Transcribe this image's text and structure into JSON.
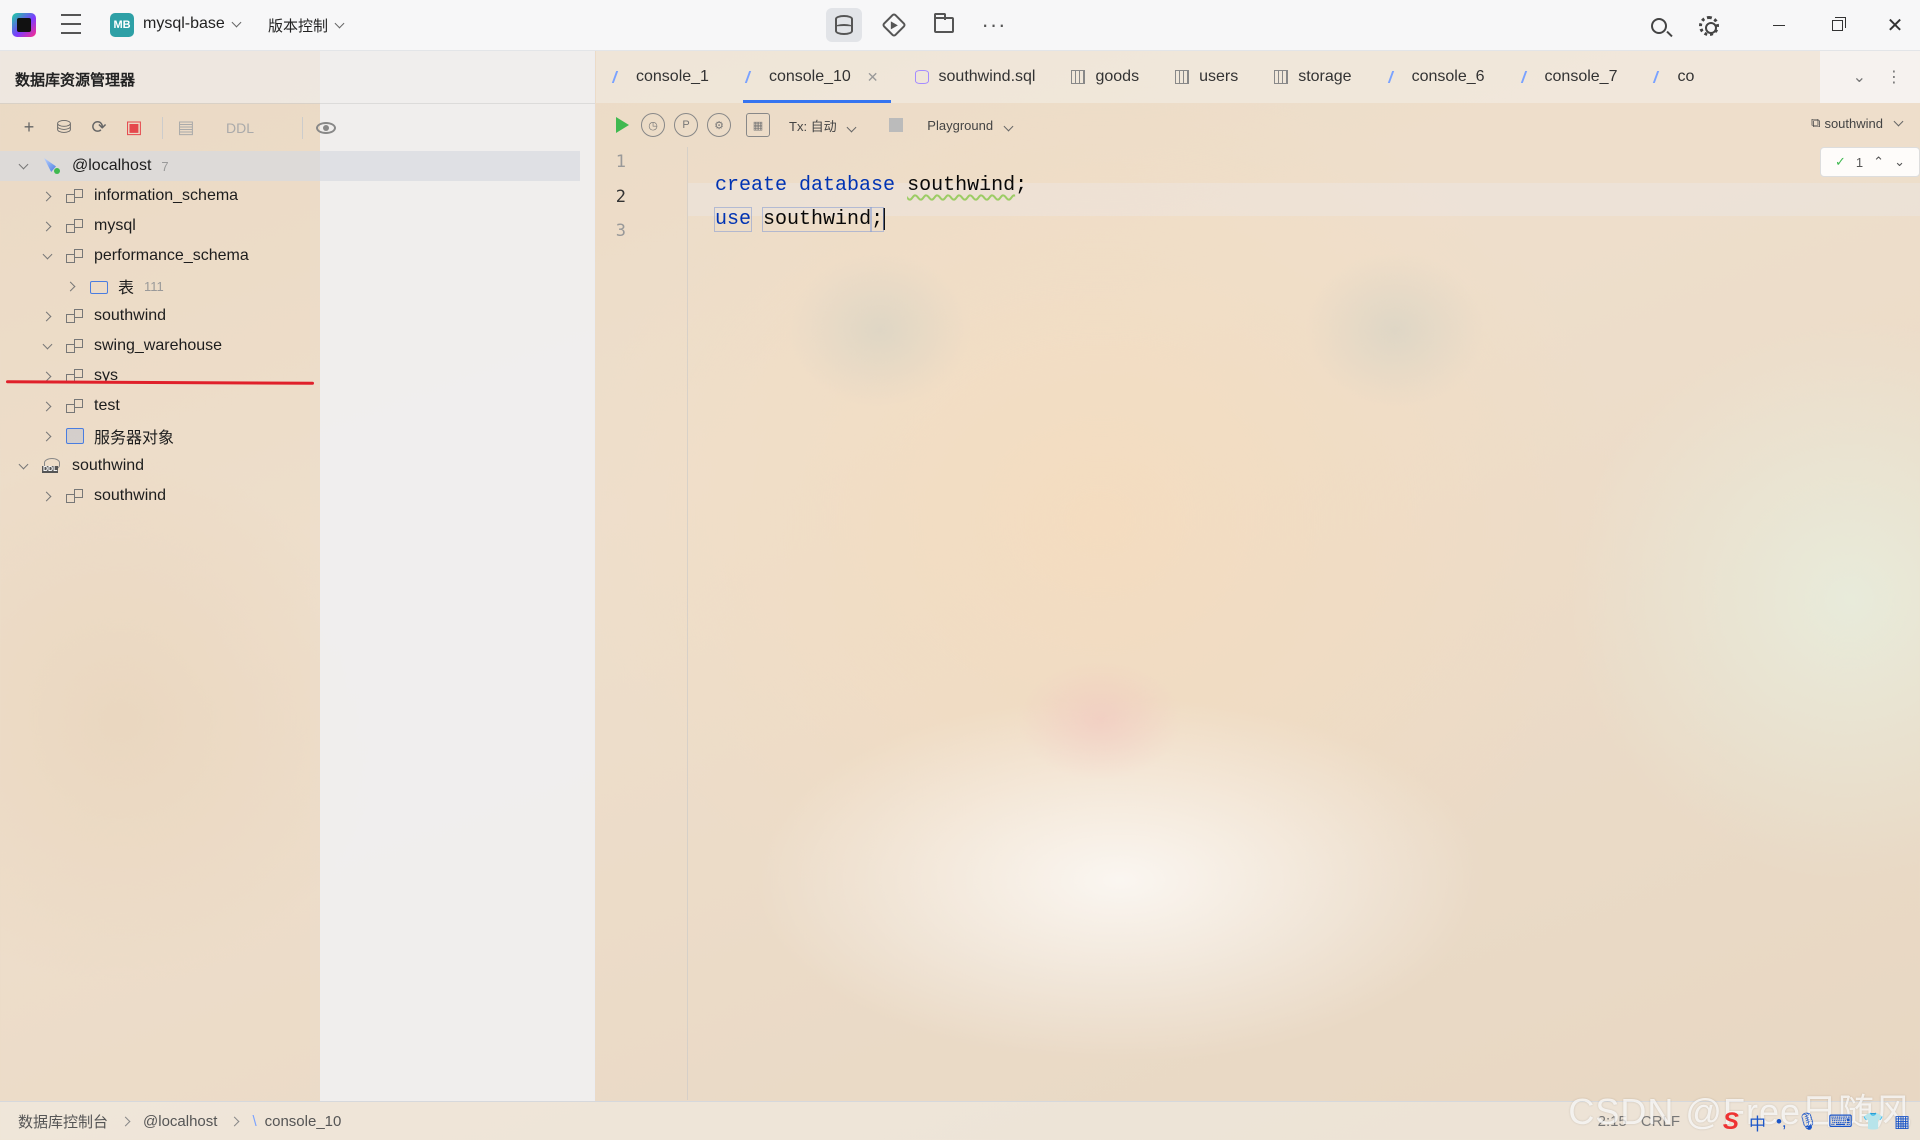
{
  "topbar": {
    "project_badge": "MB",
    "project_name": "mysql-base",
    "vcs_label": "版本控制",
    "center_icons": [
      "database-icon",
      "run-config-icon",
      "folder-icon",
      "more-icon"
    ],
    "right_icons": [
      "search-icon",
      "gear-icon",
      "minimize-icon",
      "restore-icon",
      "close-icon"
    ]
  },
  "left_panel": {
    "title": "数据库资源管理器",
    "toolbar": {
      "ddl_label": "DDL"
    },
    "tree": [
      {
        "label": "@localhost",
        "count": "7",
        "level": 0,
        "expanded": true,
        "icon": "host-icon"
      },
      {
        "label": "information_schema",
        "level": 1,
        "expanded": false,
        "icon": "schema-icon"
      },
      {
        "label": "mysql",
        "level": 1,
        "expanded": false,
        "icon": "schema-icon"
      },
      {
        "label": "performance_schema",
        "level": 1,
        "expanded": true,
        "icon": "schema-icon"
      },
      {
        "label": "表",
        "count": "111",
        "level": 2,
        "expanded": false,
        "icon": "folder-icon"
      },
      {
        "label": "southwind",
        "level": 1,
        "expanded": false,
        "icon": "schema-icon"
      },
      {
        "label": "swing_warehouse",
        "level": 1,
        "expanded": true,
        "icon": "schema-icon"
      },
      {
        "label": "sys",
        "level": 1,
        "expanded": false,
        "icon": "schema-icon"
      },
      {
        "label": "test",
        "level": 1,
        "expanded": false,
        "icon": "schema-icon"
      },
      {
        "label": "服务器对象",
        "level": 1,
        "expanded": false,
        "icon": "server-icon"
      },
      {
        "label": "southwind",
        "level": 0,
        "expanded": true,
        "icon": "ddl-icon"
      },
      {
        "label": "southwind",
        "level": 1,
        "expanded": false,
        "icon": "schema-icon"
      }
    ]
  },
  "editor": {
    "tabs": [
      {
        "label": "console_1",
        "icon": "console-icon"
      },
      {
        "label": "console_10",
        "icon": "console-icon",
        "active": true
      },
      {
        "label": "southwind.sql",
        "icon": "sql-file-icon"
      },
      {
        "label": "goods",
        "icon": "table-icon"
      },
      {
        "label": "users",
        "icon": "table-icon"
      },
      {
        "label": "storage",
        "icon": "table-icon"
      },
      {
        "label": "console_6",
        "icon": "console-icon"
      },
      {
        "label": "console_7",
        "icon": "console-icon"
      },
      {
        "label": "co",
        "icon": "console-icon"
      }
    ],
    "toolbar": {
      "tx_mode": "Tx: 自动",
      "playground": "Playground",
      "schema": "southwind"
    },
    "inspection_count": "1",
    "lines": [
      {
        "number": "1",
        "keywords": [
          "create",
          "database"
        ],
        "ident": "southwind",
        "tail": ";"
      },
      {
        "number": "2",
        "keywords": [
          "use"
        ],
        "ident": "southwind",
        "tail": ";"
      },
      {
        "number": "3"
      }
    ]
  },
  "statusbar": {
    "crumbs": [
      "数据库控制台",
      "@localhost",
      "console_10"
    ],
    "position": "2:15",
    "line_sep": "CRLF"
  },
  "watermark": "CSDN @Free日随风",
  "ime": {
    "logo": "S",
    "mode": "中"
  }
}
